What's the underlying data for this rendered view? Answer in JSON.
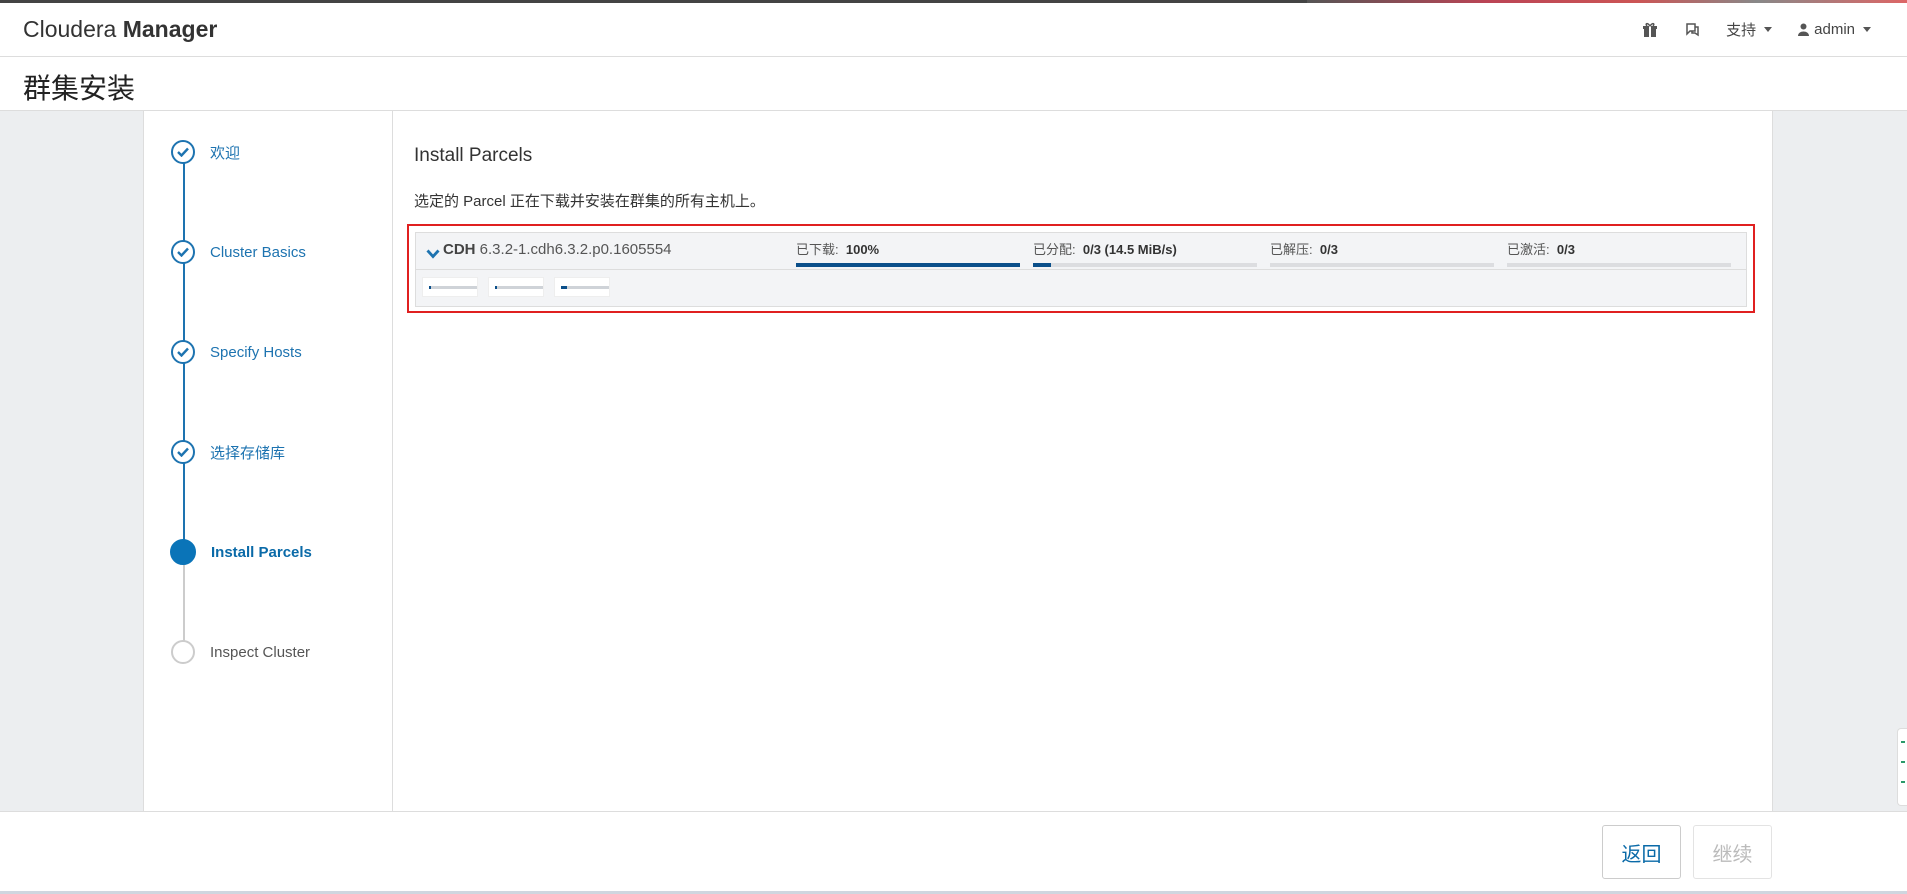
{
  "header": {
    "brand_light": "Cloudera",
    "brand_bold": "Manager",
    "support_label": "支持",
    "user_label": "admin"
  },
  "page": {
    "title": "群集安装"
  },
  "steps": [
    {
      "label": "欢迎",
      "state": "done"
    },
    {
      "label": "Cluster Basics",
      "state": "done"
    },
    {
      "label": "Specify Hosts",
      "state": "done"
    },
    {
      "label": "选择存储库",
      "state": "done"
    },
    {
      "label": "Install Parcels",
      "state": "active"
    },
    {
      "label": "Inspect Cluster",
      "state": "pending"
    }
  ],
  "main": {
    "title": "Install Parcels",
    "description": "选定的 Parcel 正在下载并安装在群集的所有主机上。",
    "parcel": {
      "name": "CDH",
      "version": "6.3.2-1.cdh6.3.2.p0.1605554",
      "stats": [
        {
          "label": "已下载:",
          "value": "100%",
          "progress": 1.0
        },
        {
          "label": "已分配:",
          "value": "0/3 (14.5 MiB/s)",
          "progress": 0.08
        },
        {
          "label": "已解压:",
          "value": "0/3",
          "progress": 0.0
        },
        {
          "label": "已激活:",
          "value": "0/3",
          "progress": 0.0
        }
      ],
      "hosts": [
        {
          "progress": 0.05
        },
        {
          "progress": 0.05
        },
        {
          "progress": 0.12
        }
      ]
    }
  },
  "footer": {
    "back_label": "返回",
    "continue_label": "继续"
  },
  "colors": {
    "accent": "#1d73b0",
    "progress": "#0b4f8a",
    "highlight": "#e02020"
  }
}
